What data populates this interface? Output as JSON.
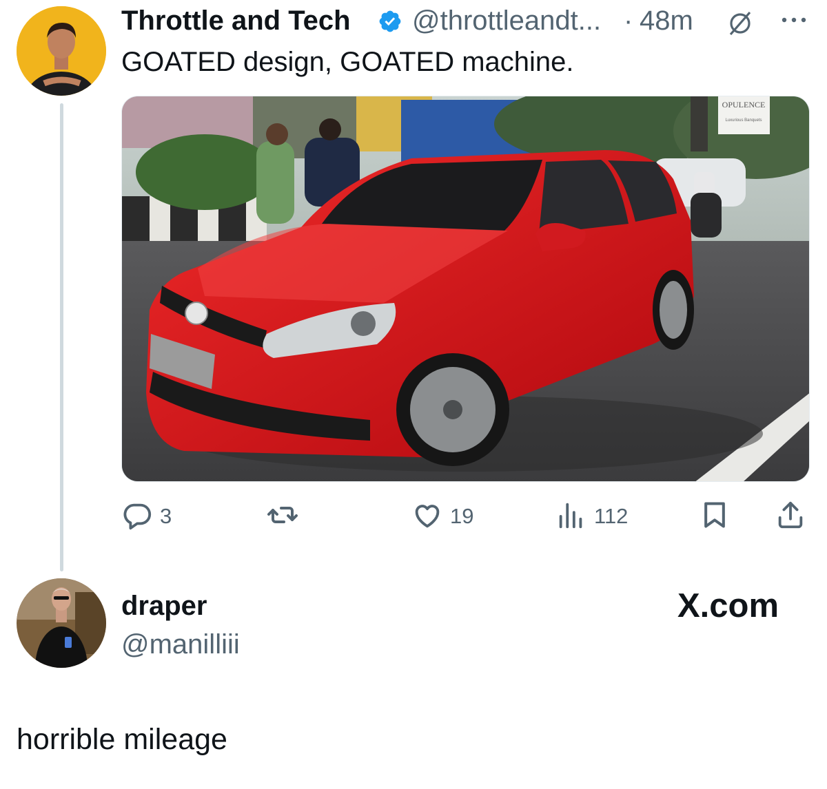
{
  "tweet": {
    "author_name": "Throttle and Tech",
    "author_handle": "@throttleandt...",
    "separator": "·",
    "time": "48m",
    "text": "GOATED design, GOATED machine.",
    "image_signs": {
      "shop": "OPULENCE",
      "shop_sub": "Luxurious Banquets"
    },
    "actions": {
      "replies": "3",
      "reposts": "",
      "likes": "19",
      "views": "112"
    },
    "icons": [
      "verified-badge-icon",
      "grok-icon",
      "more-icon",
      "reply-icon",
      "repost-icon",
      "like-icon",
      "views-icon",
      "bookmark-icon",
      "share-icon"
    ]
  },
  "reply_author": {
    "name": "draper",
    "handle": "@manilliii"
  },
  "watermark": "X.com",
  "reply_text": "horrible mileage",
  "colors": {
    "verified": "#1d9bf0",
    "secondary_text": "#536471",
    "primary_text": "#0f1419",
    "car_red": "#d8141c"
  }
}
